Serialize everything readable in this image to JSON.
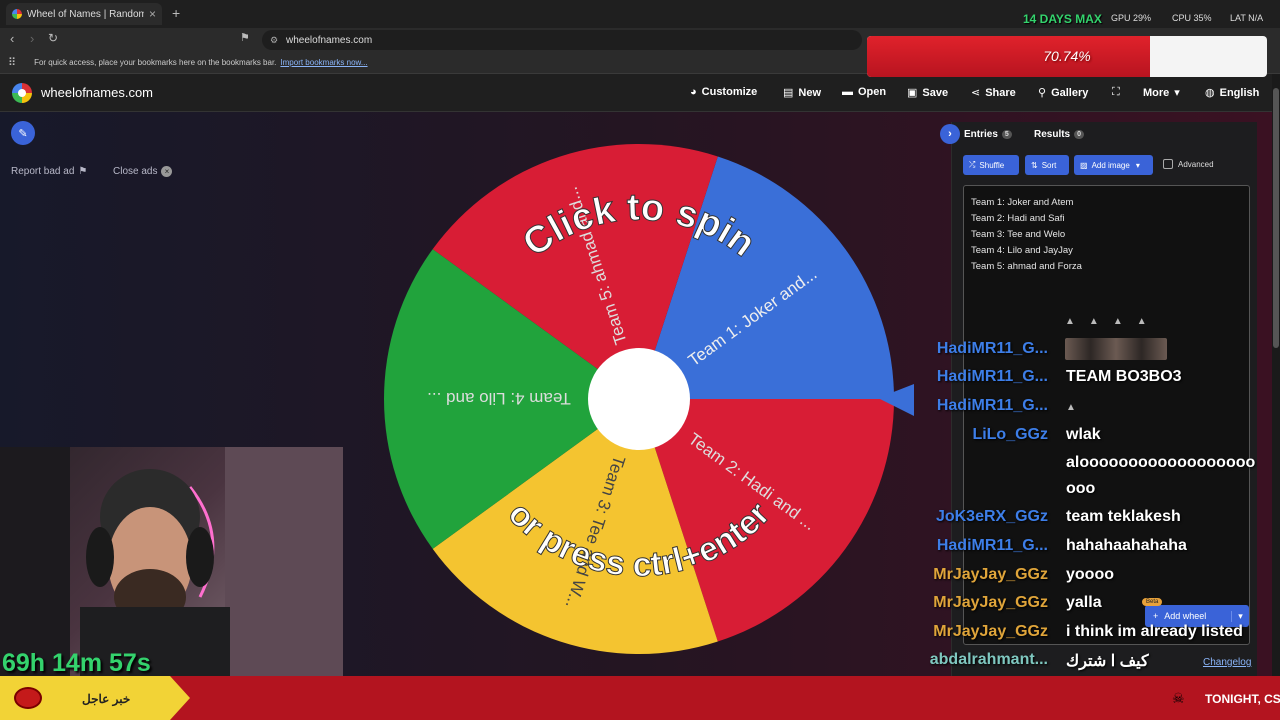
{
  "browser": {
    "tab_title": "Wheel of Names | Random name",
    "new_tab": "+",
    "url": "wheelofnames.com",
    "bookmarks_msg": "For quick access, place your bookmarks here on the bookmarks bar.",
    "import_link": "Import bookmarks now..."
  },
  "site": {
    "title": "wheelofnames.com",
    "menu": [
      {
        "label": "Customize",
        "icon": "palette-icon"
      },
      {
        "label": "New",
        "icon": "file-icon"
      },
      {
        "label": "Open",
        "icon": "folder-icon"
      },
      {
        "label": "Save",
        "icon": "save-icon"
      },
      {
        "label": "Share",
        "icon": "share-icon"
      },
      {
        "label": "Gallery",
        "icon": "search-icon"
      },
      {
        "label": "",
        "icon": "fullscreen-icon"
      },
      {
        "label": "More",
        "icon": "chevron-down-icon"
      },
      {
        "label": "English",
        "icon": "globe-icon"
      }
    ]
  },
  "ads": {
    "report": "Report bad ad",
    "close": "Close ads"
  },
  "wheel": {
    "spin_text": "Click to spin",
    "press_text": "or press ctrl+enter",
    "segments": [
      {
        "label": "Team 1: Joker and...",
        "color": "#3a6fd8"
      },
      {
        "label": "Team 2: Hadi and ...",
        "color": "#d81d35"
      },
      {
        "label": "Team 3: Tee and W...",
        "color": "#f4c430"
      },
      {
        "label": "Team 4: Lilo and ...",
        "color": "#21a33c"
      },
      {
        "label": "Team 5: ahmad and...",
        "color": "#d81d35"
      }
    ]
  },
  "panel": {
    "entries_tab": "Entries",
    "entries_count": "5",
    "results_tab": "Results",
    "results_count": "0",
    "shuffle": "Shuffle",
    "sort": "Sort",
    "add_image": "Add image",
    "advanced": "Advanced",
    "entries": [
      "Team 1: Joker and Atem",
      "Team 2: Hadi and Safi",
      "Team 3: Tee and Welo",
      "Team 4: Lilo and JayJay",
      "Team 5: ahmad and Forza"
    ],
    "add_wheel": "Add wheel",
    "beta": "Beta",
    "changelog": "Changelog"
  },
  "chat": [
    {
      "user": "HadiMR11_G...",
      "msg": "",
      "color": "#3d7ee8"
    },
    {
      "user": "HadiMR11_G...",
      "msg": "TEAM BO3BO3",
      "color": "#3d7ee8"
    },
    {
      "user": "HadiMR11_G...",
      "msg": "",
      "color": "#3d7ee8"
    },
    {
      "user": "LiLo_GGz",
      "msg": "wlak",
      "color": "#3d7ee8"
    },
    {
      "user": "",
      "msg": "aloooooooooooooooooo",
      "color": "#3d7ee8"
    },
    {
      "user": "",
      "msg": "ooo",
      "color": "#3d7ee8"
    },
    {
      "user": "JoK3eRX_GGz",
      "msg": "team teklakesh",
      "color": "#3d7ee8"
    },
    {
      "user": "HadiMR11_G...",
      "msg": "hahahaahahaha",
      "color": "#3d7ee8"
    },
    {
      "user": "MrJayJay_GGz",
      "msg": "yoooo",
      "color": "#e0a53a"
    },
    {
      "user": "MrJayJay_GGz",
      "msg": "yalla",
      "color": "#e0a53a"
    },
    {
      "user": "MrJayJay_GGz",
      "msg": "i think im already listed",
      "color": "#e0a53a"
    },
    {
      "user": "abdalrahmant...",
      "msg": "كيف ا شترك",
      "color": "#7fc8c0"
    }
  ],
  "stream": {
    "days_max": "14 DAYS MAX",
    "gpu": "GPU 29%",
    "cpu": "CPU 35%",
    "lat": "LAT N/A",
    "progress_text": "70.74%",
    "progress_value": 0.7074,
    "timer": "69h 14m 57s",
    "breaking": "خبر عاجل",
    "ticker": "TONIGHT, CS"
  }
}
